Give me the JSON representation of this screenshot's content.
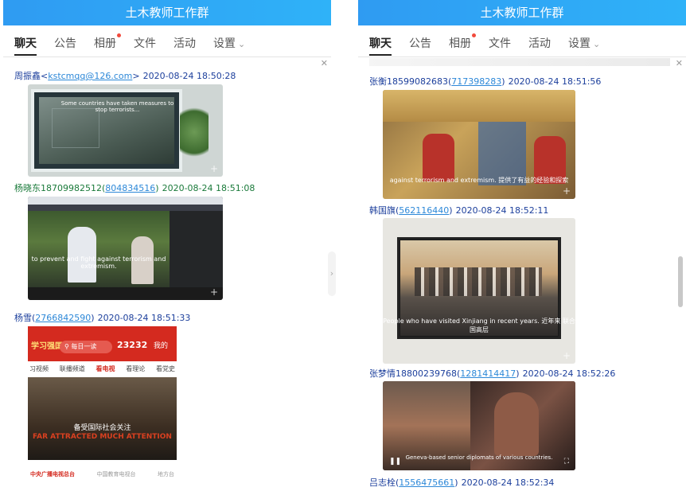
{
  "left": {
    "title": "土木教师工作群",
    "tabs": [
      "聊天",
      "公告",
      "相册",
      "文件",
      "活动",
      "设置"
    ],
    "messages": [
      {
        "name": "周振鑫",
        "email": "kstcmqq@126.com",
        "time": "2020-08-24 18:50:28",
        "caption": "Some countries have taken measures to stop terrorists..."
      },
      {
        "name": "杨晓东18709982512",
        "id": "804834516",
        "time": "2020-08-24 18:51:08",
        "caption": "to prevent and fight against terrorism and extremism."
      },
      {
        "name": "杨雪",
        "id": "2766842590",
        "time": "2020-08-24 18:51:33",
        "caption": "备受国际社会关注"
      }
    ],
    "phone": {
      "search": "每日一读",
      "score": "23232",
      "mine": "我的",
      "nav": [
        "习视频",
        "联播频道",
        "看电视",
        "看理论",
        "看党史"
      ],
      "bottom": [
        "中央广播电视总台",
        "中国教育电视台",
        "地方台"
      ],
      "bigtext": "FAR ATTRACTED MUCH ATTENTION"
    }
  },
  "right": {
    "title": "土木教师工作群",
    "tabs": [
      "聊天",
      "公告",
      "相册",
      "文件",
      "活动",
      "设置"
    ],
    "messages": [
      {
        "name": "张衡18599082683",
        "id": "717398283",
        "time": "2020-08-24 18:51:56",
        "caption": "against terrorism and extremism. 提供了有益的经验和探索"
      },
      {
        "name": "韩国旗",
        "id": "562116440",
        "time": "2020-08-24 18:52:11",
        "caption": "People who have visited Xinjiang in recent years. 近年来 联合国高层"
      },
      {
        "name": "张梦情18800239768",
        "id": "1281414417",
        "time": "2020-08-24 18:52:26",
        "caption": "Geneva-based senior diplomats of various countries."
      },
      {
        "name": "吕志栓",
        "id": "1556475661",
        "time": "2020-08-24 18:52:34"
      }
    ]
  }
}
